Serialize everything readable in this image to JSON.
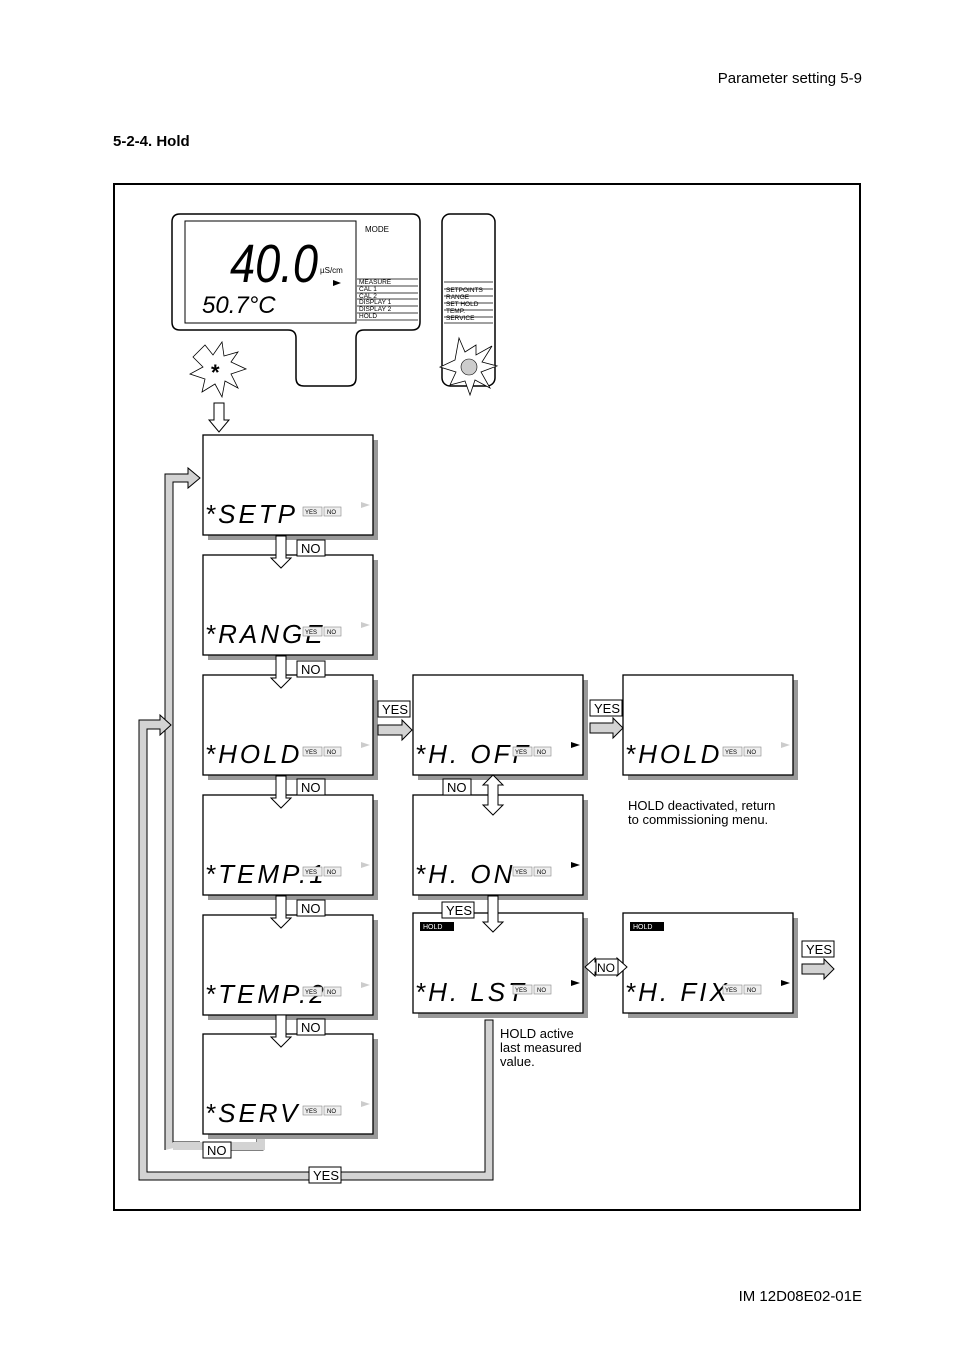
{
  "header": {
    "page_ref": "Parameter setting 5-9"
  },
  "section": {
    "title": "5-2-4. Hold"
  },
  "footer": {
    "doc_id": "IM 12D08E02-01E"
  },
  "meter": {
    "main_value": "40.0",
    "unit": "µS/cm",
    "temperature": "50.7°C",
    "mode_label": "MODE",
    "mode_items": [
      "MEASURE",
      "CAL 1",
      "CAL 2",
      "DISPLAY 1",
      "DISPLAY 2",
      "HOLD"
    ],
    "side_items": [
      "SETPOINTS",
      "RANGE",
      "SET HOLD",
      "TEMP.",
      "SERVICE"
    ]
  },
  "screens": [
    {
      "id": "setp",
      "text": "*SETP",
      "yes": "YES",
      "no": "NO"
    },
    {
      "id": "range",
      "text": "*RANGE",
      "yes": "YES",
      "no": "NO"
    },
    {
      "id": "hold",
      "text": "*HOLD",
      "yes": "YES",
      "no": "NO"
    },
    {
      "id": "temp1",
      "text": "*TEMP.1",
      "yes": "YES",
      "no": "NO"
    },
    {
      "id": "temp2",
      "text": "*TEMP.2",
      "yes": "YES",
      "no": "NO"
    },
    {
      "id": "serv",
      "text": "*SERV",
      "yes": "YES",
      "no": "NO"
    },
    {
      "id": "hoff",
      "text": "*H. OFF",
      "yes": "YES",
      "no": "NO"
    },
    {
      "id": "hold2",
      "text": "*HOLD",
      "yes": "YES",
      "no": "NO"
    },
    {
      "id": "hon",
      "text": "*H. ON",
      "yes": "YES",
      "no": "NO"
    },
    {
      "id": "hlst",
      "text": "*H. LST",
      "yes": "YES",
      "no": "NO",
      "badge": "HOLD"
    },
    {
      "id": "hfix",
      "text": "*H. FIX",
      "yes": "YES",
      "no": "NO",
      "badge": "HOLD"
    }
  ],
  "flow_labels": {
    "no": "NO",
    "yes": "YES"
  },
  "notes": {
    "deactivated": [
      "HOLD deactivated, return",
      "to commissioning menu."
    ],
    "active": [
      "HOLD active",
      "last measured",
      "value."
    ]
  }
}
